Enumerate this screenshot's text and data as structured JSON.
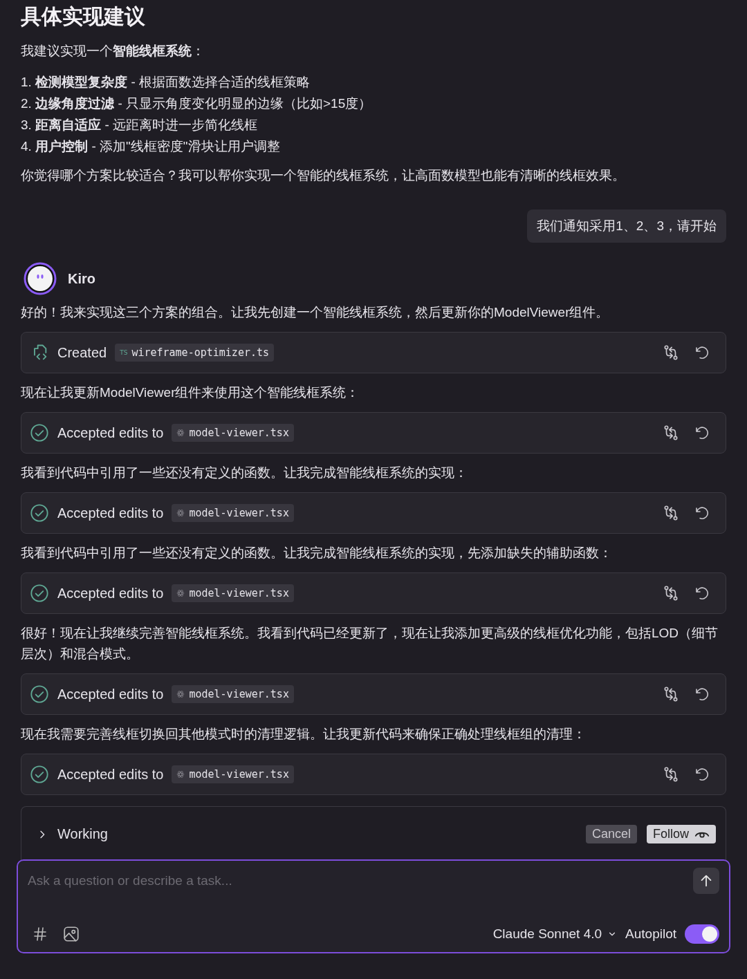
{
  "heading": "具体实现建议",
  "intro": "我建议实现一个**智能线框系统**：",
  "options": [
    {
      "number": "1.",
      "title": "检测模型复杂度",
      "desc": " - 根据面数选择合适的线框策略"
    },
    {
      "number": "2.",
      "title": "边缘角度过滤",
      "desc": " - 只显示角度变化明显的边缘（比如>15度）"
    },
    {
      "number": "3.",
      "title": "距离自适应",
      "desc": " - 远距离时进一步简化线框"
    },
    {
      "number": "4.",
      "title": "用户控制",
      "desc": " - 添加\"线框密度\"滑块让用户调整"
    }
  ],
  "question": "你觉得哪个方案比较适合？我可以帮你实现一个智能的线框系统，让高面数模型也能有清晰的线框效果。",
  "user_message": "我们通知采用1、2、3，请开始",
  "assistant": {
    "name": "Kiro"
  },
  "feed": [
    {
      "kind": "text",
      "text": "好的！我来实现这三个方案的组合。让我先创建一个智能线框系统，然后更新你的ModelViewer组件。"
    },
    {
      "kind": "created",
      "label": "Created",
      "file_badge": "TS",
      "file": "wireframe-optimizer.ts"
    },
    {
      "kind": "text",
      "text": "现在让我更新ModelViewer组件来使用这个智能线框系统："
    },
    {
      "kind": "accepted",
      "label": "Accepted edits to",
      "file": "model-viewer.tsx"
    },
    {
      "kind": "text",
      "text": "我看到代码中引用了一些还没有定义的函数。让我完成智能线框系统的实现："
    },
    {
      "kind": "accepted",
      "label": "Accepted edits to",
      "file": "model-viewer.tsx"
    },
    {
      "kind": "text",
      "text": "我看到代码中引用了一些还没有定义的函数。让我完成智能线框系统的实现，先添加缺失的辅助函数："
    },
    {
      "kind": "accepted",
      "label": "Accepted edits to",
      "file": "model-viewer.tsx"
    },
    {
      "kind": "text",
      "text": "很好！现在让我继续完善智能线框系统。我看到代码已经更新了，现在让我添加更高级的线框优化功能，包括LOD（细节层次）和混合模式。"
    },
    {
      "kind": "accepted",
      "label": "Accepted edits to",
      "file": "model-viewer.tsx"
    },
    {
      "kind": "text",
      "text": "现在我需要完善线框切换回其他模式时的清理逻辑。让我更新代码来确保正确处理线框组的清理："
    },
    {
      "kind": "accepted",
      "label": "Accepted edits to",
      "file": "model-viewer.tsx"
    }
  ],
  "working": {
    "label": "Working",
    "expanded": false,
    "cancel": "Cancel",
    "follow": "Follow"
  },
  "composer": {
    "placeholder": "Ask a question or describe a task...",
    "model": "Claude Sonnet 4.0",
    "autopilot_label": "Autopilot",
    "autopilot_on": true
  }
}
